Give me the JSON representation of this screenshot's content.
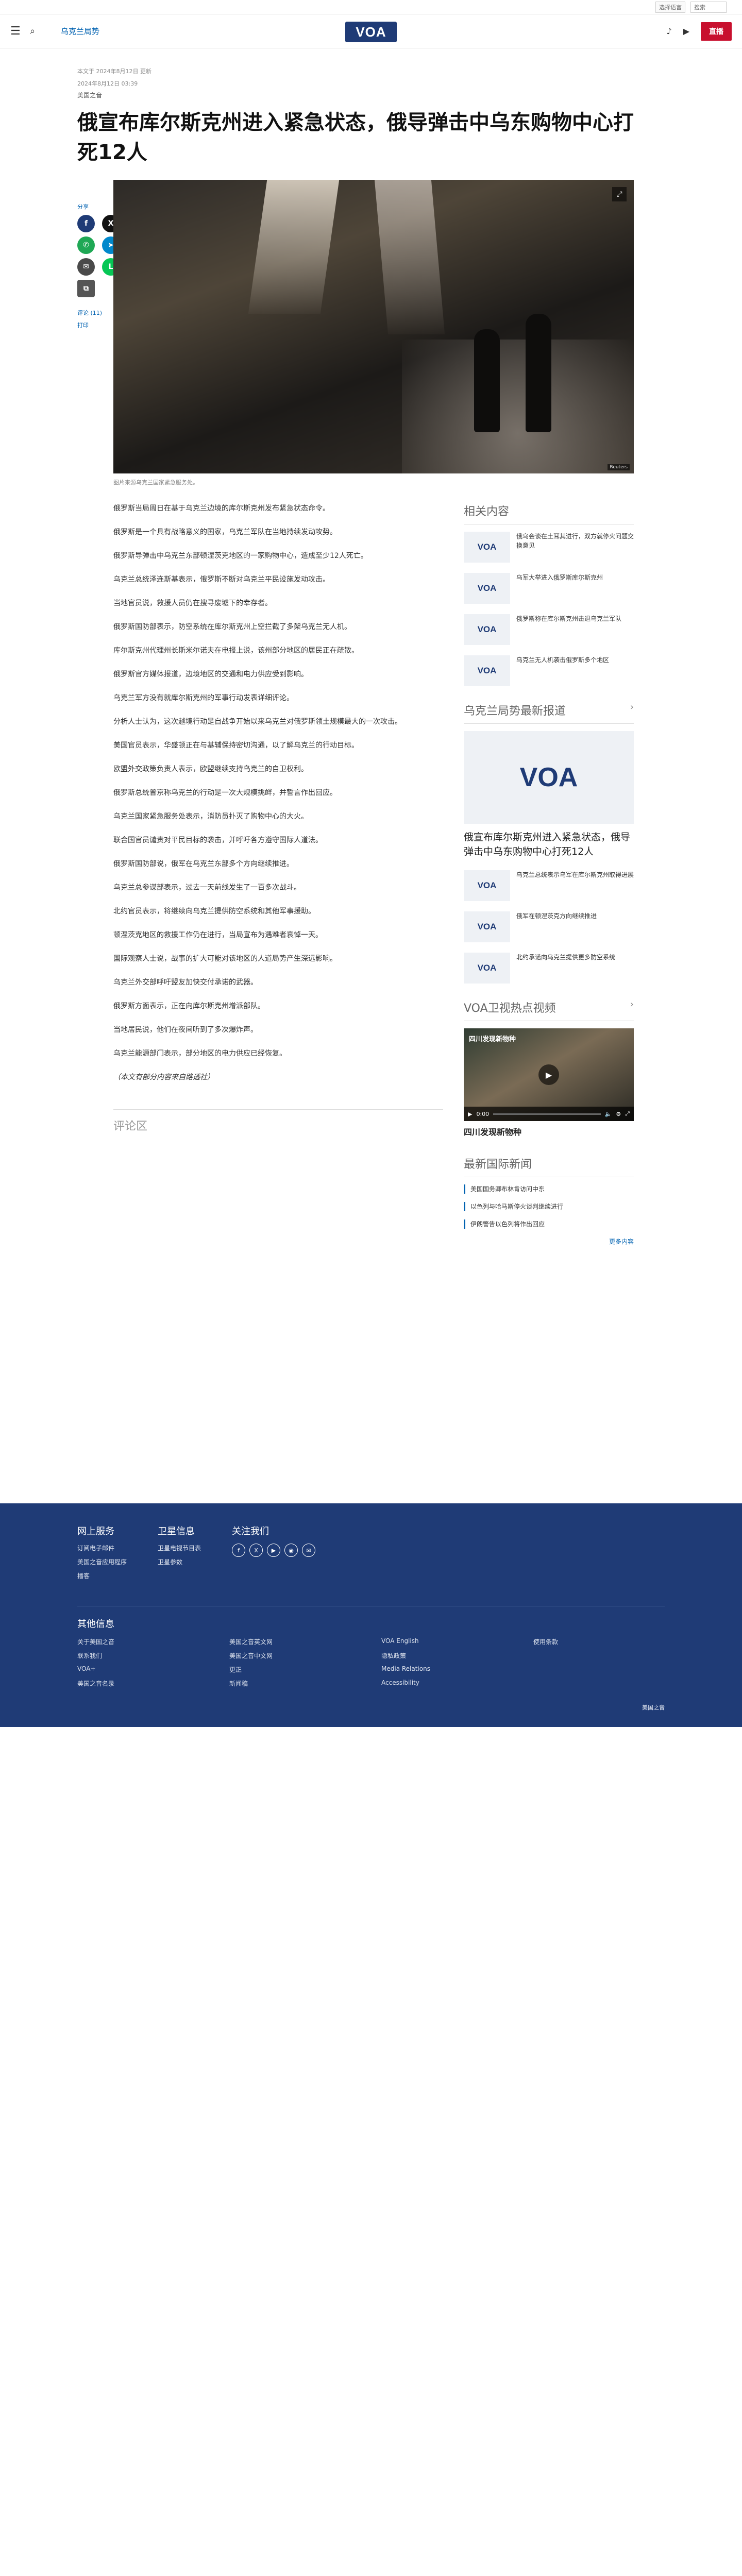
{
  "utility": {
    "language": "选择语言",
    "search_placeholder": "搜索"
  },
  "header": {
    "section": "乌克兰局势",
    "logo": "VOA",
    "live_label": "直播"
  },
  "article": {
    "updated": "本文于 2024年8月12日 更新",
    "date": "2024年8月12日 03:39",
    "source": "美国之音",
    "headline": "俄宣布库尔斯克州进入紧急状态，俄导弹击中乌东购物中心打死12人",
    "share_label": "分享",
    "comments_link": "评论 (11)",
    "print_link": "打印",
    "hero_credit": "Reuters",
    "caption": "图片来源乌克兰国家紧急服务处。",
    "paragraphs": [
      "俄罗斯当局周日在基于乌克兰边境的库尔斯克州发布紧急状态命令。",
      "俄罗斯是一个具有战略意义的国家，乌克兰军队在当地持续发动攻势。",
      "俄罗斯导弹击中乌克兰东部顿涅茨克地区的一家购物中心，造成至少12人死亡。",
      "乌克兰总统泽连斯基表示，俄罗斯不断对乌克兰平民设施发动攻击。",
      "当地官员说，救援人员仍在搜寻废墟下的幸存者。",
      "俄罗斯国防部表示，防空系统在库尔斯克州上空拦截了多架乌克兰无人机。",
      "库尔斯克州代理州长斯米尔诺夫在电报上说，该州部分地区的居民正在疏散。",
      "俄罗斯官方媒体报道，边境地区的交通和电力供应受到影响。",
      "乌克兰军方没有就库尔斯克州的军事行动发表详细评论。",
      "分析人士认为，这次越境行动是自战争开始以来乌克兰对俄罗斯领土规模最大的一次攻击。",
      "美国官员表示，华盛顿正在与基辅保持密切沟通，以了解乌克兰的行动目标。",
      "欧盟外交政策负责人表示，欧盟继续支持乌克兰的自卫权利。",
      "俄罗斯总统普京称乌克兰的行动是一次大规模挑衅，并誓言作出回应。",
      "乌克兰国家紧急服务处表示，消防员扑灭了购物中心的大火。",
      "联合国官员谴责对平民目标的袭击，并呼吁各方遵守国际人道法。",
      "俄罗斯国防部说，俄军在乌克兰东部多个方向继续推进。",
      "乌克兰总参谋部表示，过去一天前线发生了一百多次战斗。",
      "北约官员表示，将继续向乌克兰提供防空系统和其他军事援助。",
      "顿涅茨克地区的救援工作仍在进行，当局宣布为遇难者哀悼一天。",
      "国际观察人士说，战事的扩大可能对该地区的人道局势产生深远影响。",
      "乌克兰外交部呼吁盟友加快交付承诺的武器。",
      "俄罗斯方面表示，正在向库尔斯克州增派部队。",
      "当地居民说，他们在夜间听到了多次爆炸声。",
      "乌克兰能源部门表示，部分地区的电力供应已经恢复。",
      "（本文有部分内容来自路透社）"
    ],
    "comments_heading": "评论区"
  },
  "sidebar": {
    "related_title": "相关内容",
    "related": [
      "俄乌会谈在土耳其进行，双方就停火问题交换意见",
      "乌军大举进入俄罗斯库尔斯克州",
      "俄罗斯称在库尔斯克州击退乌克兰军队",
      "乌克兰无人机袭击俄罗斯多个地区"
    ],
    "more_title": "乌克兰局势最新报道",
    "feature_title": "俄宣布库尔斯克州进入紧急状态，俄导弹击中乌东购物中心打死12人",
    "more_items": [
      "乌克兰总统表示乌军在库尔斯克州取得进展",
      "俄军在顿涅茨克方向继续推进",
      "北约承诺向乌克兰提供更多防空系统"
    ],
    "video_title": "VOA卫视热点视频",
    "video_overlay": "四川发现新物种",
    "video_time": "0:00",
    "video_caption": "四川发现新物种",
    "latest_title": "最新国际新闻",
    "latest": [
      "美国国务卿布林肯访问中东",
      "以色列与哈马斯停火谈判继续进行",
      "伊朗警告以色列将作出回应"
    ],
    "more_link": "更多内容"
  },
  "footer": {
    "col1_title": "网上服务",
    "col1": [
      "订阅电子邮件",
      "美国之音应用程序",
      "播客"
    ],
    "col2_title": "卫星信息",
    "col2": [
      "卫星电视节目表",
      "卫星参数"
    ],
    "col3_title": "关注我们",
    "social": [
      "f",
      "X",
      "▶",
      "◉",
      "✉"
    ],
    "other_title": "其他信息",
    "other": [
      "关于美国之音",
      "美国之音英文网",
      "VOA English",
      "使用条款",
      "联系我们",
      "美国之音中文网",
      "隐私政策",
      "",
      "VOA+",
      "更正",
      "Media Relations",
      "",
      "美国之音名录",
      "新闻稿",
      "Accessibility",
      ""
    ],
    "copyright": "美国之音"
  },
  "colors": {
    "brand": "#1f3b76",
    "live": "#c8102e",
    "link": "#0162b1"
  }
}
